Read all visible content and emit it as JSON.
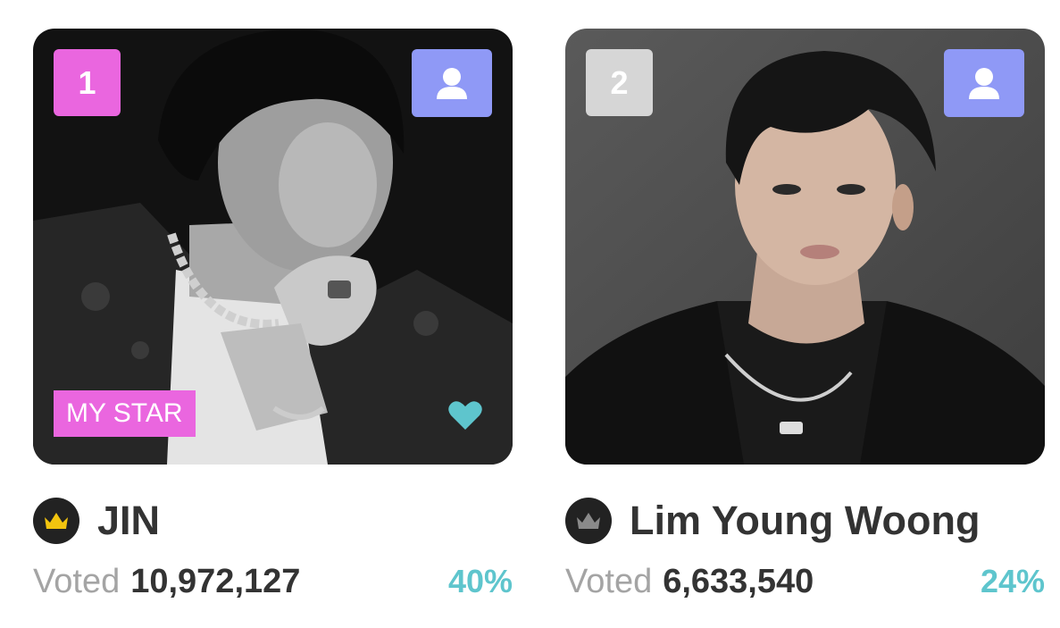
{
  "cards": [
    {
      "rank": "1",
      "rank_color": "#ea66df",
      "badge": "MY STAR",
      "name": "JIN",
      "voted_label": "Voted",
      "votes": "10,972,127",
      "percent": "40%",
      "crown_color": "#f2c40f",
      "icons": [
        "person-icon",
        "heart-icon",
        "crown-icon"
      ]
    },
    {
      "rank": "2",
      "rank_color": "#d6d6d6",
      "name": "Lim Young Woong",
      "voted_label": "Voted",
      "votes": "6,633,540",
      "percent": "24%",
      "crown_color": "#8a8a8a",
      "icons": [
        "person-icon",
        "crown-icon"
      ]
    }
  ],
  "colors": {
    "profile_button": "#8f99f6",
    "percent": "#5ec5cd",
    "heart": "#5ec5cd"
  }
}
